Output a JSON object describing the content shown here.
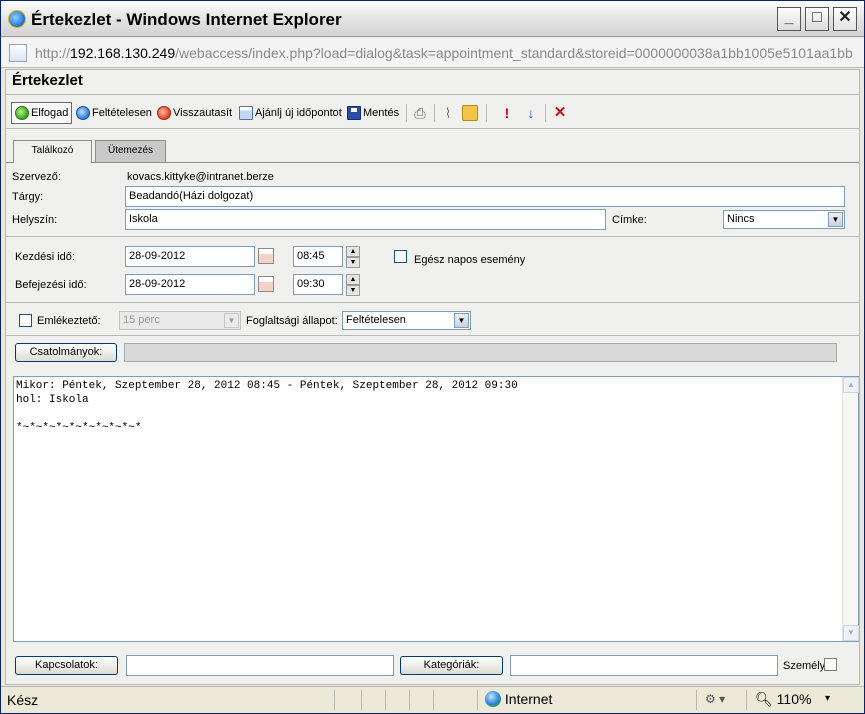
{
  "window": {
    "title": "Értekezlet - Windows Internet Explorer",
    "min_label": "_",
    "max_label": "□",
    "close_label": "✕"
  },
  "address": {
    "prefix": "http://",
    "host": "192.168.130.249",
    "path": "/webaccess/index.php?load=dialog&task=appointment_standard&storeid=0000000038a1bb1005e5101aa1bb"
  },
  "page": {
    "title": "Értekezlet"
  },
  "toolbar": {
    "accept": "Elfogad",
    "tentative": "Feltételesen",
    "decline": "Visszautasít",
    "propose": "Ajánlj új időpontot",
    "save": "Mentés",
    "priority_high_symbol": "!",
    "priority_low_symbol": "↓",
    "delete_symbol": "✕"
  },
  "tabs": [
    {
      "label": "Találkozó"
    },
    {
      "label": "Ütemezés"
    }
  ],
  "form": {
    "organizer_label": "Szervező:",
    "organizer_value": "kovacs.kittyke@intranet.berze",
    "subject_label": "Tárgy:",
    "subject_value": "Beadandó(Házi dolgozat)",
    "location_label": "Helyszín:",
    "location_value": "Iskola",
    "label_label": "Címke:",
    "label_value": "Nincs",
    "start_label": "Kezdési idő:",
    "start_date": "28-09-2012",
    "start_time": "08:45",
    "end_label": "Befejezési idő:",
    "end_date": "28-09-2012",
    "end_time": "09:30",
    "allday_label": "Egész napos esemény",
    "reminder_label": "Emlékeztető:",
    "reminder_value": "15 perc",
    "busy_label": "Foglaltsági állapot:",
    "busy_value": "Feltételesen",
    "attachments_button": "Csatolmányok:",
    "body_text": "Mikor: Péntek, Szeptember 28, 2012 08:45 - Péntek, Szeptember 28, 2012 09:30\nhol: Iskola\n\n*~*~*~*~*~*~*~*~*~*",
    "contacts_button": "Kapcsolatok:",
    "categories_button": "Kategóriák:",
    "private_label": "Személy"
  },
  "statusbar": {
    "status": "Kész",
    "zone": "Internet",
    "zoom": "110%"
  }
}
